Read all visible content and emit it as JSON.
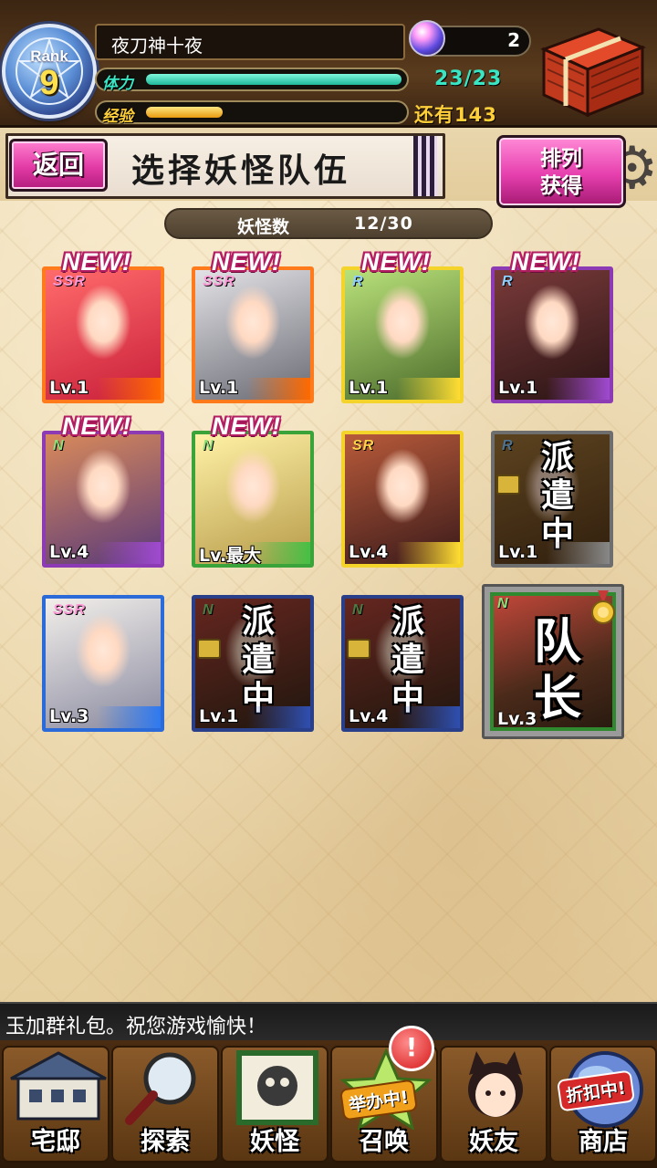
{
  "header": {
    "rank_label": "Rank",
    "rank_value": "9",
    "player_name": "夜刀神十夜",
    "stamina_label": "体力",
    "stamina_value": "23/23",
    "stamina_fraction": 1.0,
    "exp_label": "经验",
    "exp_remaining": "还有143",
    "exp_fraction": 0.3,
    "gem_count": "2"
  },
  "title_bar": {
    "back_label": "返回",
    "title": "选择妖怪队伍",
    "sort_line1": "排列",
    "sort_line2": "获得"
  },
  "count": {
    "label": "妖怪数",
    "value": "12/30"
  },
  "cards": [
    {
      "rarity": "SSR",
      "level": "Lv.1",
      "new": "NEW!",
      "frame": "#ff7a1a",
      "bar": "#ff6a00",
      "bg1": "#ff6b6b",
      "bg2": "#c91f3a"
    },
    {
      "rarity": "SSR",
      "level": "Lv.1",
      "new": "NEW!",
      "frame": "#ff7a1a",
      "bar": "#ff6a00",
      "bg1": "#e2e2e6",
      "bg2": "#6b6b75"
    },
    {
      "rarity": "R",
      "level": "Lv.1",
      "new": "NEW!",
      "frame": "#f4d32b",
      "bar": "#ffdd33",
      "bg1": "#b9e17a",
      "bg2": "#4b6b2a"
    },
    {
      "rarity": "R",
      "level": "Lv.1",
      "new": "NEW!",
      "frame": "#8c3bb5",
      "bar": "#a04ad0",
      "bg1": "#7a3a3a",
      "bg2": "#2a1414"
    },
    {
      "rarity": "N",
      "level": "Lv.4",
      "new": "NEW!",
      "frame": "#8c3bb5",
      "bar": "#a04ad0",
      "bg1": "#d98a5a",
      "bg2": "#5a3a7a"
    },
    {
      "rarity": "N",
      "level": "Lv.最大",
      "new": "NEW!",
      "frame": "#3aa33a",
      "bar": "#46c046",
      "bg1": "#fff2a6",
      "bg2": "#b79a4a"
    },
    {
      "rarity": "SR",
      "level": "Lv.4",
      "new": "",
      "frame": "#f4d32b",
      "bar": "#ffdd33",
      "bg1": "#b85a3a",
      "bg2": "#3a1a1a"
    },
    {
      "rarity": "R",
      "level": "Lv.1",
      "new": "",
      "frame": "#6e6e6e",
      "bar": "#888888",
      "bg1": "#a87a3a",
      "bg2": "#5a3a1a",
      "dispatch": "派遣中"
    },
    {
      "rarity": "SSR",
      "level": "Lv.3",
      "new": "",
      "frame": "#2a6ad9",
      "bar": "#2f7af0",
      "bg1": "#f2efea",
      "bg2": "#8a8aa0"
    },
    {
      "rarity": "N",
      "level": "Lv.1",
      "new": "",
      "frame": "#2a3f8a",
      "bar": "#2f4fb0",
      "bg1": "#b8463a",
      "bg2": "#3a2a1a",
      "dispatch": "派遣中"
    },
    {
      "rarity": "N",
      "level": "Lv.4",
      "new": "",
      "frame": "#2a3f8a",
      "bar": "#2f4fb0",
      "bg1": "#b8463a",
      "bg2": "#3a2a1a",
      "dispatch": "派遣中"
    }
  ],
  "leader_card": {
    "rarity": "N",
    "level": "Lv.3",
    "label": "队长"
  },
  "ticker": "玉加群礼包。祝您游戏愉快！",
  "nav": [
    {
      "label": "宅邸",
      "badge": ""
    },
    {
      "label": "探索",
      "badge": ""
    },
    {
      "label": "妖怪",
      "badge": ""
    },
    {
      "label": "召唤",
      "badge": "举办中!",
      "alert": "!"
    },
    {
      "label": "妖友",
      "badge": ""
    },
    {
      "label": "商店",
      "badge": "折扣中!"
    }
  ],
  "colors": {
    "stamina": "#39e6c4",
    "exp": "#ffcf3a",
    "accent_pink": "#e23aa5"
  }
}
